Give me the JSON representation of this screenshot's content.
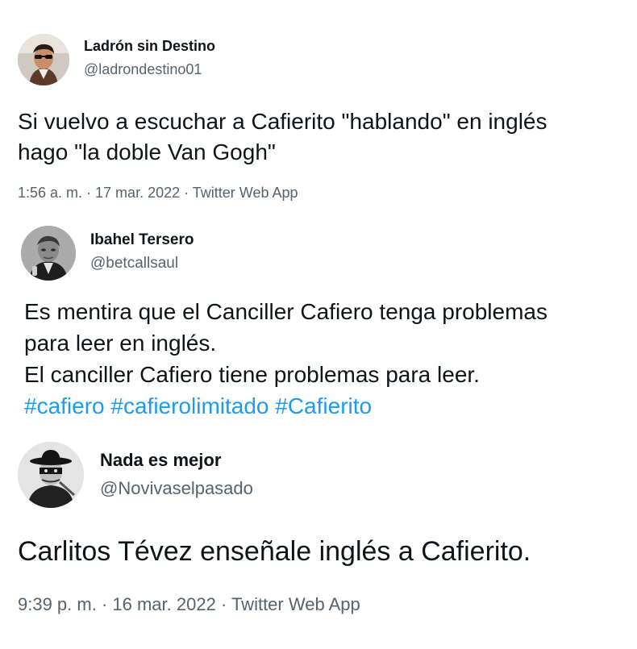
{
  "tweets": [
    {
      "author": {
        "name": "Ladrón sin Destino",
        "handle": "@ladrondestino01",
        "avatar_icon": "profile-photo"
      },
      "text_lines": [
        "Si vuelvo a escuchar a Cafierito \"hablando\" en inglés",
        "hago \"la doble Van Gogh\""
      ],
      "meta": "1:56 a. m. · 17 mar. 2022 · Twitter Web App"
    },
    {
      "author": {
        "name": "Ibahel Tersero",
        "handle": "@betcallsaul",
        "avatar_icon": "profile-photo"
      },
      "text_lines": [
        "Es mentira que el Canciller Cafiero tenga problemas",
        "para leer en inglés.",
        "El canciller Cafiero tiene problemas para leer."
      ],
      "hashtags": "#cafiero #cafierolimitado #Cafierito"
    },
    {
      "author": {
        "name": "Nada es mejor",
        "handle": "@Novivaselpasado",
        "avatar_icon": "profile-photo"
      },
      "text_lines": [
        "Carlitos Tévez enseñale inglés a Cafierito."
      ],
      "meta": "9:39 p. m. · 16 mar. 2022 · Twitter Web App"
    }
  ],
  "colors": {
    "text": "#0f1419",
    "secondary": "#536471",
    "hashtag": "#1d9bf0",
    "background": "#ffffff"
  }
}
